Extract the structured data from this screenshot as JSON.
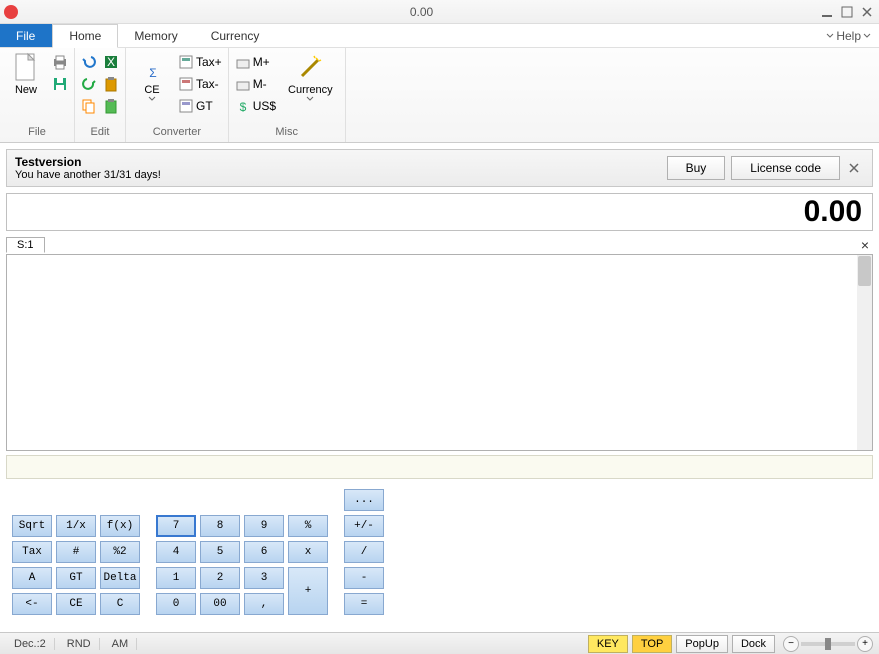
{
  "window": {
    "title": "0.00"
  },
  "menu": {
    "file": "File",
    "home": "Home",
    "memory": "Memory",
    "currency": "Currency",
    "help": "Help"
  },
  "ribbon": {
    "file": {
      "new": "New",
      "label": "File"
    },
    "edit": {
      "ce": "CE",
      "label": "Edit"
    },
    "converter": {
      "taxplus": "Tax+",
      "taxminus": "Tax-",
      "gt": "GT",
      "label": "Converter"
    },
    "misc": {
      "mplus": "M+",
      "mminus": "M-",
      "uss": "US$",
      "currency": "Currency",
      "label": "Misc"
    }
  },
  "trial": {
    "title": "Testversion",
    "subtitle": "You have another 31/31 days!",
    "buy": "Buy",
    "license": "License code"
  },
  "display": {
    "value": "0.00"
  },
  "tape": {
    "tab": "S:1"
  },
  "keys": {
    "func": [
      "Sqrt",
      "1/x",
      "f(x)",
      "Tax",
      "#",
      "%2",
      "A",
      "GT",
      "Delta",
      "<-",
      "CE",
      "C"
    ],
    "num": [
      "7",
      "8",
      "9",
      "%",
      "4",
      "5",
      "6",
      "x",
      "1",
      "2",
      "3",
      "0",
      "00",
      ","
    ],
    "op_dots": "...",
    "op": [
      "+/-",
      "/",
      "-",
      "+",
      "="
    ]
  },
  "status": {
    "dec": "Dec.:2",
    "rnd": "RND",
    "am": "AM",
    "key": "KEY",
    "top": "TOP",
    "popup": "PopUp",
    "dock": "Dock"
  }
}
